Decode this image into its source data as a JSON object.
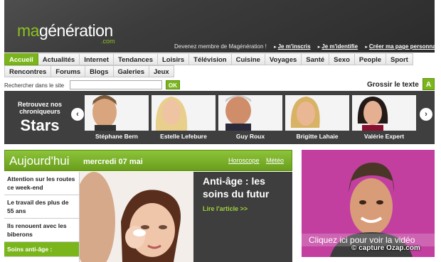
{
  "header": {
    "logo_a": "ma",
    "logo_b": "génération",
    "logo_sub": ".com",
    "member_text": "Devenez membre de Magénération !",
    "links": [
      "Je m'inscris",
      "Je m'identifie",
      "Créer ma page personnalisée"
    ]
  },
  "nav": {
    "row1": [
      "Accueil",
      "Actualités",
      "Internet",
      "Tendances",
      "Loisirs",
      "Télévision",
      "Cuisine",
      "Voyages",
      "Santé",
      "Sexo",
      "People",
      "Sport"
    ],
    "row2": [
      "Rencontres",
      "Forums",
      "Blogs",
      "Galeries",
      "Jeux"
    ]
  },
  "search": {
    "label": "Rechercher dans le site",
    "value": "",
    "button": "OK",
    "grossir_label": "Grossir le texte",
    "grossir_btn": "A"
  },
  "stars": {
    "tagline": "Retrouvez nos chroniqueurs",
    "title": "Stars",
    "prev": "‹",
    "next": "›",
    "items": [
      "Stéphane Bern",
      "Estelle Lefebure",
      "Guy Roux",
      "Brigitte Lahaie",
      "Valérie Expert"
    ]
  },
  "aujourdhui": {
    "title": "Aujourd'hui",
    "date": "mercredi 07 mai",
    "horoscope": "Horoscope",
    "meteo": "Météo",
    "list": [
      "Attention sur les routes ce week-end",
      "Le travail des plus de 55 ans",
      "Ils renouent avec les biberons",
      "Soins anti-âge :"
    ],
    "feature_title": "Anti-âge : les soins du futur",
    "feature_link": "Lire l'article >>"
  },
  "video": {
    "cta": "Cliquez ici pour voir la vidéo",
    "credit": "© capture Ozap.com"
  },
  "colors": {
    "accent": "#7bb51c",
    "dark": "#3f3f3f",
    "video_bg": "#c23fa0"
  }
}
